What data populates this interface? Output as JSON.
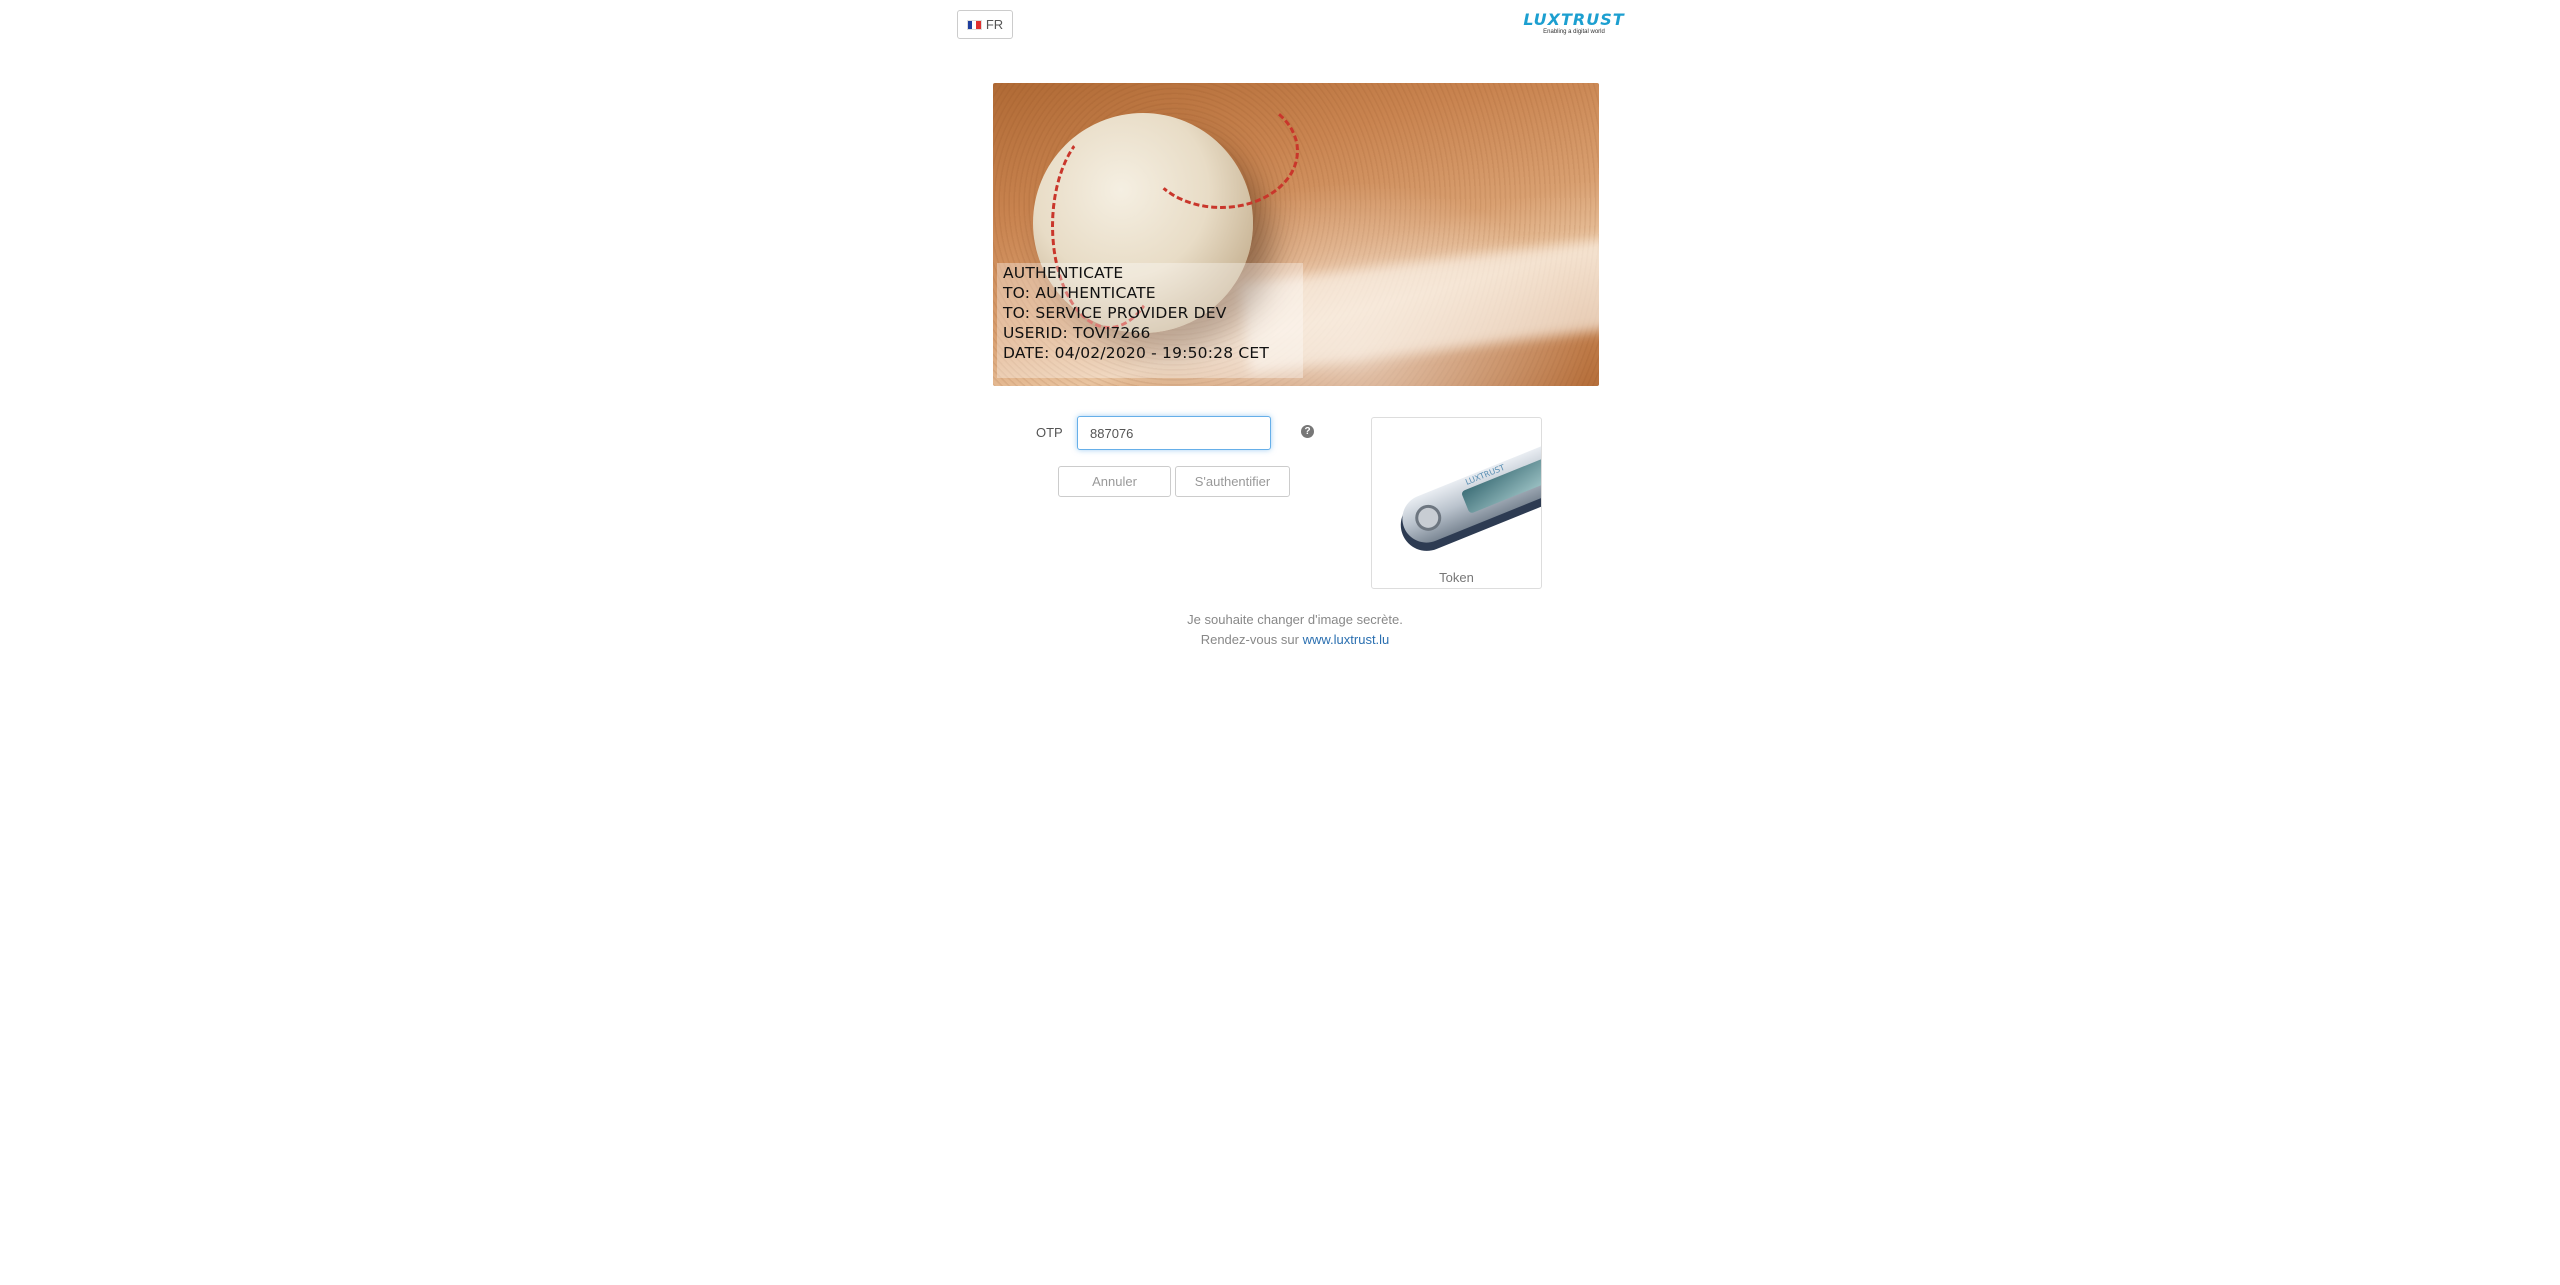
{
  "header": {
    "language": "FR",
    "logo": {
      "name": "LUXTRUST",
      "tagline": "Enabling a digital world"
    }
  },
  "secret_image": {
    "lines": [
      "AUTHENTICATE",
      "TO: AUTHENTICATE",
      "TO: SERVICE PROVIDER DEV",
      "USERID: TOVI7266",
      "DATE: 04/02/2020 - 19:50:28 CET"
    ]
  },
  "form": {
    "otp_label": "OTP",
    "otp_value": "887076",
    "cancel_label": "Annuler",
    "submit_label": "S'authentifier",
    "help_icon": "question-circle-icon"
  },
  "token": {
    "label": "Token",
    "screen_text": "LUXTRUST"
  },
  "footer": {
    "change_image_text": "Je souhaite changer d'image secrète.",
    "visit_text": "Rendez-vous sur ",
    "link_text": "www.luxtrust.lu"
  },
  "colors": {
    "accent": "#66afe9",
    "link": "#2a6fb0",
    "logo": "#1c9fd0"
  }
}
